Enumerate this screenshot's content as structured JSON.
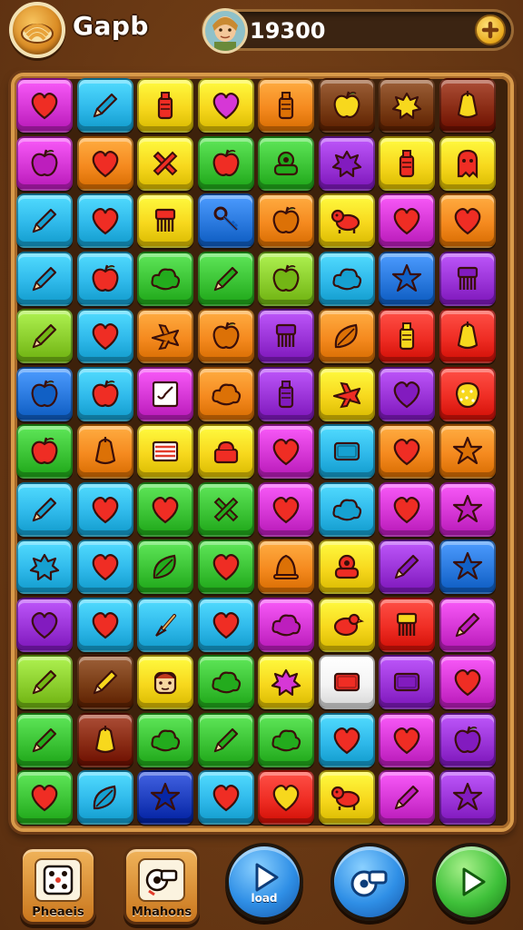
{
  "header": {
    "logo_icon": "pasta-icon",
    "title": "Gapb",
    "avatar_icon": "avatar",
    "score": "19300",
    "plus_icon": "plus-icon"
  },
  "palette": {
    "red": "#ef2d24",
    "orange": "#f58a1f",
    "yellow": "#f7d81d",
    "green": "#3cc436",
    "lime": "#8ccf2e",
    "cyan": "#2fb9ea",
    "blue": "#2a79de",
    "navy": "#1f3fbf",
    "purple": "#9b34d8",
    "magenta": "#d637d6",
    "brown": "#7a3d16",
    "maroon": "#8a2c15",
    "white": "#f4f4f4"
  },
  "board": {
    "rows": [
      [
        [
          "magenta",
          "heart"
        ],
        [
          "cyan",
          "pencil"
        ],
        [
          "yellow",
          "bottle"
        ],
        [
          "yellow",
          "heart"
        ],
        [
          "orange",
          "bottle"
        ],
        [
          "brown",
          "apple"
        ],
        [
          "brown",
          "splat"
        ],
        [
          "maroon",
          "fruit"
        ]
      ],
      [
        [
          "magenta",
          "apple"
        ],
        [
          "orange",
          "heart"
        ],
        [
          "yellow",
          "cross"
        ],
        [
          "green",
          "apple"
        ],
        [
          "green",
          "toy"
        ],
        [
          "purple",
          "splat"
        ],
        [
          "yellow",
          "bottle"
        ],
        [
          "yellow",
          "ghost"
        ]
      ],
      [
        [
          "cyan",
          "pencil"
        ],
        [
          "cyan",
          "heart"
        ],
        [
          "yellow",
          "comb"
        ],
        [
          "blue",
          "keys"
        ],
        [
          "orange",
          "apple"
        ],
        [
          "yellow",
          "dog"
        ],
        [
          "magenta",
          "heart"
        ],
        [
          "orange",
          "heart"
        ]
      ],
      [
        [
          "cyan",
          "pencil"
        ],
        [
          "cyan",
          "apple"
        ],
        [
          "green",
          "cloud"
        ],
        [
          "green",
          "pencil"
        ],
        [
          "lime",
          "apple"
        ],
        [
          "cyan",
          "cloud"
        ],
        [
          "blue",
          "star"
        ],
        [
          "purple",
          "comb"
        ]
      ],
      [
        [
          "lime",
          "pencil"
        ],
        [
          "cyan",
          "heart"
        ],
        [
          "orange",
          "plane"
        ],
        [
          "orange",
          "apple"
        ],
        [
          "purple",
          "comb"
        ],
        [
          "orange",
          "leaf"
        ],
        [
          "red",
          "bottle"
        ],
        [
          "red",
          "fruit"
        ]
      ],
      [
        [
          "blue",
          "apple"
        ],
        [
          "cyan",
          "apple"
        ],
        [
          "magenta",
          "note"
        ],
        [
          "orange",
          "cloud"
        ],
        [
          "purple",
          "bottle"
        ],
        [
          "yellow",
          "plane"
        ],
        [
          "purple",
          "heart"
        ],
        [
          "red",
          "berry"
        ]
      ],
      [
        [
          "green",
          "apple"
        ],
        [
          "orange",
          "fruit"
        ],
        [
          "yellow",
          "stripes"
        ],
        [
          "yellow",
          "cake"
        ],
        [
          "magenta",
          "heart"
        ],
        [
          "cyan",
          "box"
        ],
        [
          "orange",
          "heart"
        ],
        [
          "orange",
          "star"
        ]
      ],
      [
        [
          "cyan",
          "pencil"
        ],
        [
          "cyan",
          "heart"
        ],
        [
          "green",
          "heart"
        ],
        [
          "green",
          "cross"
        ],
        [
          "magenta",
          "heart"
        ],
        [
          "cyan",
          "cloud"
        ],
        [
          "magenta",
          "heart"
        ],
        [
          "magenta",
          "star"
        ]
      ],
      [
        [
          "cyan",
          "splat"
        ],
        [
          "cyan",
          "heart"
        ],
        [
          "green",
          "leaf"
        ],
        [
          "green",
          "heart"
        ],
        [
          "orange",
          "bell"
        ],
        [
          "yellow",
          "toy"
        ],
        [
          "purple",
          "pencil"
        ],
        [
          "blue",
          "star"
        ]
      ],
      [
        [
          "purple",
          "heart"
        ],
        [
          "cyan",
          "heart"
        ],
        [
          "cyan",
          "brush"
        ],
        [
          "cyan",
          "heart"
        ],
        [
          "magenta",
          "cloud"
        ],
        [
          "yellow",
          "bird"
        ],
        [
          "red",
          "comb"
        ],
        [
          "magenta",
          "pencil"
        ]
      ],
      [
        [
          "lime",
          "pencil"
        ],
        [
          "brown",
          "pencil"
        ],
        [
          "yellow",
          "face"
        ],
        [
          "green",
          "cloud"
        ],
        [
          "yellow",
          "splat"
        ],
        [
          "white",
          "box"
        ],
        [
          "purple",
          "box"
        ],
        [
          "magenta",
          "heart"
        ]
      ],
      [
        [
          "green",
          "pencil"
        ],
        [
          "maroon",
          "fruit"
        ],
        [
          "green",
          "cloud"
        ],
        [
          "green",
          "pencil"
        ],
        [
          "green",
          "cloud"
        ],
        [
          "cyan",
          "heart"
        ],
        [
          "magenta",
          "heart"
        ],
        [
          "purple",
          "apple"
        ]
      ],
      [
        [
          "green",
          "heart"
        ],
        [
          "cyan",
          "leaf"
        ],
        [
          "navy",
          "star"
        ],
        [
          "cyan",
          "heart"
        ],
        [
          "red",
          "heart"
        ],
        [
          "yellow",
          "dog"
        ],
        [
          "magenta",
          "pencil"
        ],
        [
          "purple",
          "star"
        ]
      ]
    ]
  },
  "footer": {
    "btn1": {
      "label": "Pheaeis",
      "icon": "dice-icon"
    },
    "btn2": {
      "label": "Mhahons",
      "icon": "whistle-icon"
    },
    "btn3": {
      "label": "load",
      "icon": "play-icon",
      "color": "#2f8fe6"
    },
    "btn4": {
      "label": "",
      "icon": "whistle-icon",
      "color": "#2f8fe6"
    },
    "btn5": {
      "label": "",
      "icon": "play-icon",
      "color": "#3fc13a"
    }
  }
}
